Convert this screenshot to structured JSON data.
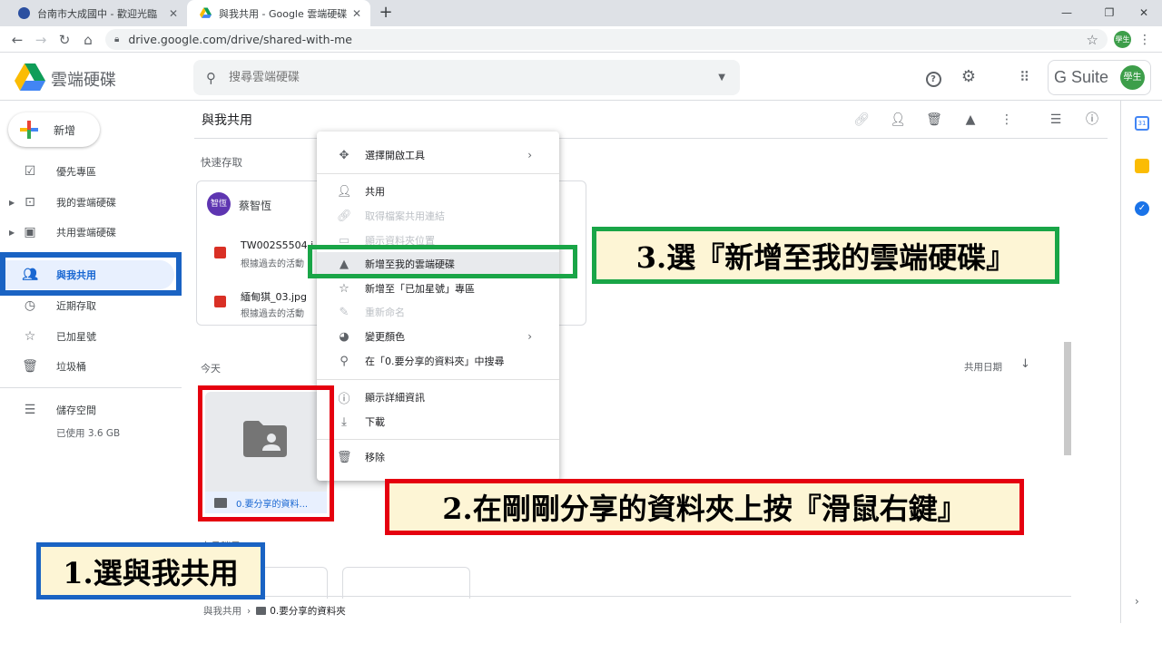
{
  "browser": {
    "tabs": [
      {
        "title": "台南市大成國中 - 歡迎光臨",
        "active": false
      },
      {
        "title": "與我共用 - Google 雲端硬碟",
        "active": true
      }
    ],
    "new_tab": "+",
    "url": "drive.google.com/drive/shared-with-me",
    "profile_label": "學生"
  },
  "header": {
    "app_name": "雲端硬碟",
    "search_placeholder": "搜尋雲端硬碟",
    "gsuite_label": "G Suite",
    "avatar_label": "學生"
  },
  "sidebar": {
    "new_button": "新增",
    "items": [
      {
        "label": "優先專區",
        "icon": "check-box-icon"
      },
      {
        "label": "我的雲端硬碟",
        "icon": "my-drive-icon"
      },
      {
        "label": "共用雲端硬碟",
        "icon": "shared-drives-icon"
      },
      {
        "label": "與我共用",
        "icon": "people-icon"
      },
      {
        "label": "近期存取",
        "icon": "clock-icon"
      },
      {
        "label": "已加星號",
        "icon": "star-icon"
      },
      {
        "label": "垃圾桶",
        "icon": "trash-icon"
      }
    ],
    "storage_label": "儲存空間",
    "storage_used": "已使用 3.6 GB"
  },
  "main": {
    "title": "與我共用",
    "quick_access_label": "快速存取",
    "owner_avatar": "智恆",
    "owner_name": "蔡智恆",
    "quick_files": [
      {
        "name": "TW002S5504.j",
        "sub": "根據過去的活動"
      },
      {
        "name": "緬甸猉_03.jpg",
        "sub": "根據過去的活動"
      }
    ],
    "today_label": "今天",
    "sort_label": "共用日期",
    "folder_name": "0.要分享的資料...",
    "recent_label": "本月稍早",
    "breadcrumb": {
      "root": "與我共用",
      "current": "0.要分享的資料夾"
    }
  },
  "context_menu": {
    "items": [
      {
        "label": "選擇開啟工具",
        "icon": "move-arrows-icon",
        "disabled": false,
        "submenu": true
      },
      {
        "label": "共用",
        "icon": "person-add-icon",
        "disabled": false,
        "submenu": false
      },
      {
        "label": "取得檔案共用連結",
        "icon": "link-icon",
        "disabled": true,
        "submenu": false
      },
      {
        "label": "顯示資料夾位置",
        "icon": "folder-icon",
        "disabled": true,
        "submenu": false
      },
      {
        "label": "新增至我的雲端硬碟",
        "icon": "add-to-drive-icon",
        "disabled": false,
        "submenu": false,
        "highlighted": true
      },
      {
        "label": "新增至「已加星號」專區",
        "icon": "star-icon",
        "disabled": false,
        "submenu": false
      },
      {
        "label": "重新命名",
        "icon": "pencil-icon",
        "disabled": true,
        "submenu": false
      },
      {
        "label": "變更顏色",
        "icon": "palette-icon",
        "disabled": false,
        "submenu": true
      },
      {
        "label": "在「0.要分享的資料夾」中搜尋",
        "icon": "search-icon",
        "disabled": false,
        "submenu": false
      },
      {
        "label": "顯示詳細資訊",
        "icon": "info-icon",
        "disabled": false,
        "submenu": false
      },
      {
        "label": "下載",
        "icon": "download-icon",
        "disabled": false,
        "submenu": false
      },
      {
        "label": "移除",
        "icon": "trash-icon",
        "disabled": false,
        "submenu": false
      }
    ]
  },
  "annotations": {
    "step1": "1.選與我共用",
    "step2": "2.在剛剛分享的資料夾上按『滑鼠右鍵』",
    "step3": "3.選『新增至我的雲端硬碟』"
  },
  "colors": {
    "step1_border": "#1a63c3",
    "step2_border": "#e5000f",
    "step3_border": "#19a547",
    "callout_fill": "#fdf5d5",
    "selected_nav": "#1967d2"
  }
}
